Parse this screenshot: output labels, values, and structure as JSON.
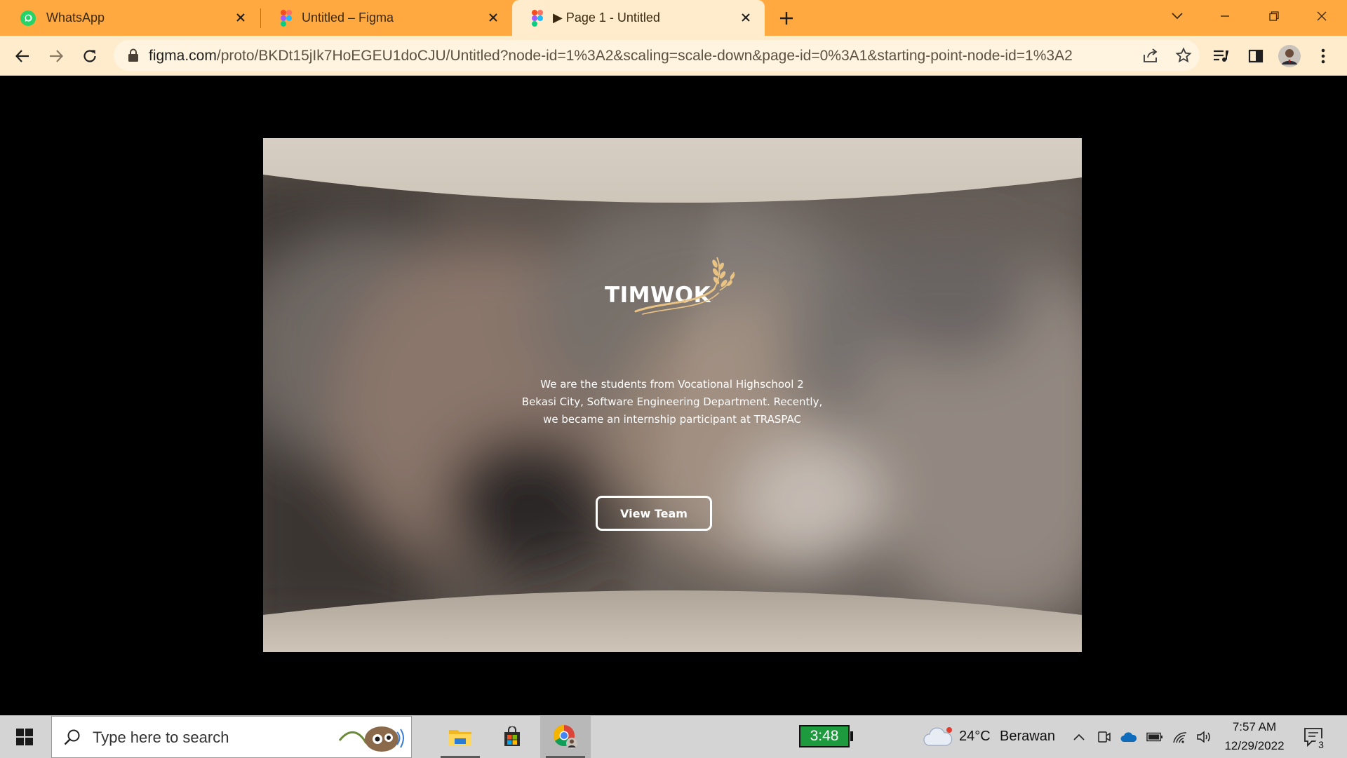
{
  "tabs": [
    {
      "title": "WhatsApp",
      "icon": "whatsapp-icon",
      "active": false
    },
    {
      "title": "Untitled – Figma",
      "icon": "figma-icon",
      "active": false
    },
    {
      "title": "▶ Page 1 - Untitled",
      "icon": "figma-icon",
      "active": true
    }
  ],
  "address_bar": {
    "host": "figma.com",
    "path": "/proto/BKDt15jIk7HoEGEU1doCJU/Untitled?node-id=1%3A2&scaling=scale-down&page-id=0%3A1&starting-point-node-id=1%3A2"
  },
  "prototype": {
    "logo_text": "TIMWOK",
    "intro_lines": [
      "We are the  students from Vocational Highschool 2",
      "Bekasi City, Software Engineering Department. Recently,",
      "we became an internship participant at TRASPAC"
    ],
    "cta_label": "View Team"
  },
  "taskbar": {
    "search_placeholder": "Type here to search",
    "pinned_apps": [
      "file-explorer-icon",
      "microsoft-store-icon",
      "chrome-icon"
    ],
    "battery_widget": "3:48",
    "weather_temp": "24°C",
    "weather_desc": "Berawan",
    "time": "7:57 AM",
    "date": "12/29/2022",
    "notification_count": "3"
  },
  "colors": {
    "tabstrip": "#ffa940",
    "toolbar": "#ffeccc",
    "logo_gold": "#e8c384",
    "band": "#d1c8bc",
    "battery_green": "#1e9a3e"
  }
}
